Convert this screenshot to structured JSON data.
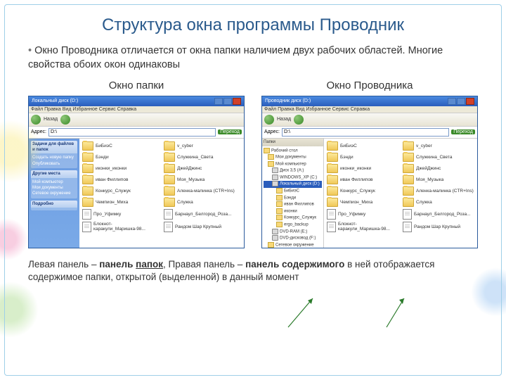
{
  "title": "Структура окна программы Проводник",
  "bullet": "Окно Проводника отличается от окна папки наличием двух рабочих областей. Многие свойства обоих окон одинаковы",
  "columns": {
    "left": "Окно папки",
    "right": "Окно Проводника"
  },
  "win": {
    "title_left": "Локальный диск (D:)",
    "title_right": "Проводник диск (D:)",
    "menu": "Файл  Правка  Вид  Избранное  Сервис  Справка",
    "nav": "Назад",
    "addr_label": "Адрес:",
    "addr_value": "D:\\",
    "go": "Переход",
    "tasks": {
      "h1": "Задачи для файлов и папок",
      "i1": "Создать новую папку",
      "i2": "Опубликовать",
      "h2": "Другие места",
      "i3": "Мой компьютер",
      "i4": "Мои документы",
      "i5": "Сетевое окружение",
      "h3": "Подробно"
    },
    "tree": {
      "h": "Папки",
      "n0": "Рабочий стол",
      "n1": "Мои документы",
      "n2": "Мой компьютер",
      "n3": "Диск 3,5 (A:)",
      "n4": "WINDOWS_XP (C:)",
      "n5": "Локальный диск (D:)",
      "n6": "БиБиэС",
      "n7": "Бэнди",
      "n8": "иван Филлипов",
      "n9": "иконки",
      "n10": "Конкурс_Служук",
      "n11": "ergo_backup",
      "n12": "DVD-RAM (E:)",
      "n13": "DVD-дисковод (F:)",
      "n14": "Сетевое окружение"
    },
    "items": {
      "c1": "БиБиэС",
      "c2": "v_cyber",
      "c3": "Бэнди",
      "c4": "Служкина_Света",
      "c5": "иконки_иконки",
      "c6": "ДжейДжинс",
      "c7": "иван Филлипов",
      "c8": "Моя_Музыка",
      "c9": "Конкурс_Служук",
      "c10": "Аленка-малинка (CTR+Ins)",
      "c11": "Чемпион_Миха",
      "c12": "Служка",
      "c13": "Про_Уфимку",
      "c14": "Барнаул_Белгород_Роза...",
      "c15": "Блокнот-каракули_Маришка-98...",
      "c16": "Рандом Шар Крупный"
    }
  },
  "footer": {
    "p": "Левая панель – ",
    "b1": "панель ",
    "b1u": "папок",
    "m": ", Правая панель – ",
    "b2": "панель содержимого",
    "e": " в ней отображается содержимое папки, открытой (выделенной) в данный момент"
  }
}
